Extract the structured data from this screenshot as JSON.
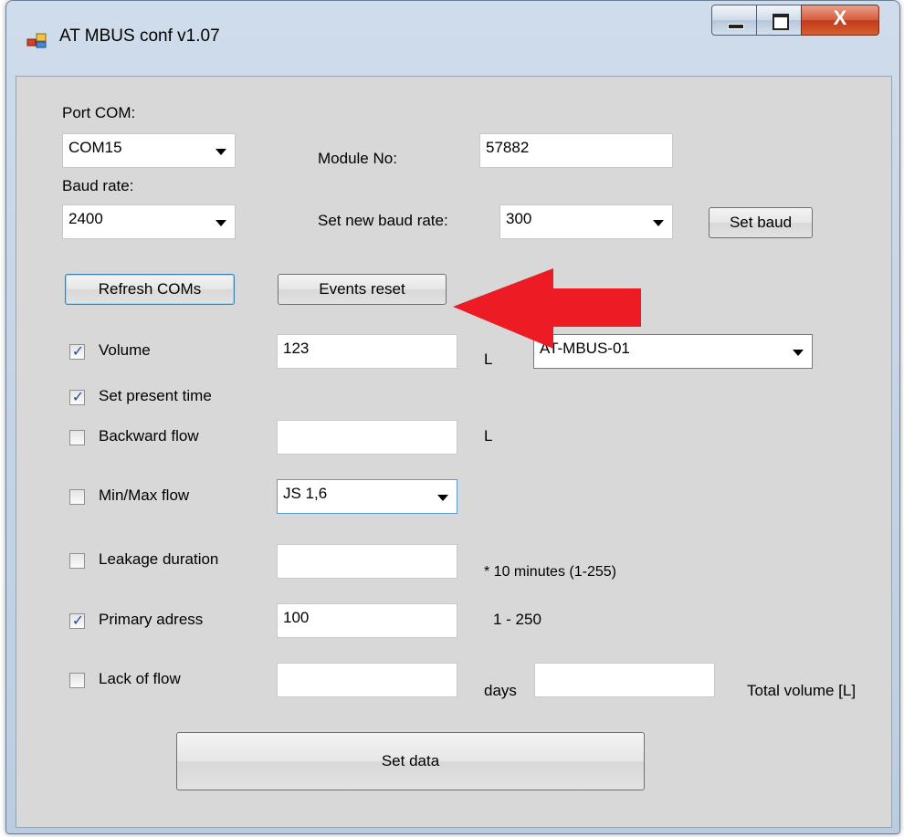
{
  "window": {
    "title": "AT MBUS conf v1.07",
    "controls": {
      "minimize": "—",
      "maximize": "□",
      "close": "X"
    }
  },
  "port": {
    "label": "Port COM:",
    "selected": "COM15"
  },
  "baud": {
    "label": "Baud rate:",
    "selected": "2400"
  },
  "module": {
    "label": "Module No:",
    "value": "57882"
  },
  "new_baud": {
    "label": "Set new baud rate:",
    "selected": "300",
    "button": "Set baud"
  },
  "buttons": {
    "refresh": "Refresh COMs",
    "events_reset": "Events reset",
    "set_data": "Set data"
  },
  "rows": {
    "volume": {
      "label": "Volume",
      "checked": true,
      "value": "123",
      "unit": "L",
      "device": "AT-MBUS-01"
    },
    "present_time": {
      "label": "Set present time",
      "checked": true
    },
    "backward": {
      "label": "Backward flow",
      "checked": false,
      "value": "",
      "unit": "L"
    },
    "minmax": {
      "label": "Min/Max flow",
      "checked": false,
      "selected": "JS 1,6"
    },
    "leakage": {
      "label": "Leakage duration",
      "checked": false,
      "value": "",
      "note": "* 10 minutes (1-255)"
    },
    "primary": {
      "label": "Primary adress",
      "checked": true,
      "value": "100",
      "note": "1 - 250"
    },
    "lack": {
      "label": "Lack of flow",
      "checked": false,
      "value": "",
      "unit": "days",
      "total_value": "",
      "total_label": "Total volume [L]"
    }
  },
  "colors": {
    "arrow": "#ed1c24",
    "client_bg": "#d8d8d8"
  },
  "icons": {
    "app": "app-window-icon",
    "arrow": "red-arrow-annotation"
  }
}
